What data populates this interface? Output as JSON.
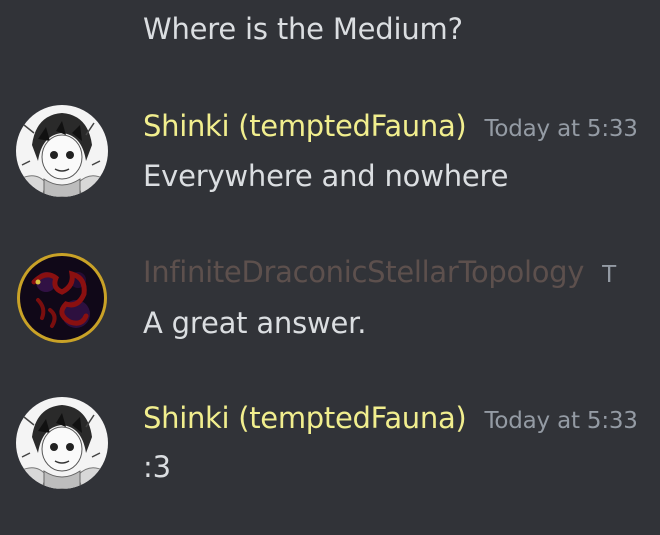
{
  "colors": {
    "background": "#313338",
    "text": "#dbdee1",
    "timestamp": "#949ba4"
  },
  "messages": [
    {
      "text": "Where is the Medium?"
    },
    {
      "author": "Shinki (temptedFauna)",
      "author_color": "#f1ee8e",
      "timestamp": "Today at 5:33",
      "text": "Everywhere and nowhere",
      "avatar_icon": "anime-girl-sketch-avatar"
    },
    {
      "author": "InfiniteDraconicStellarTopology",
      "author_color": "#5d504d",
      "timestamp": "T",
      "text": "A great answer.",
      "avatar_icon": "dragon-avatar"
    },
    {
      "author": "Shinki (temptedFauna)",
      "author_color": "#f1ee8e",
      "timestamp": "Today at 5:33",
      "text": ":3",
      "avatar_icon": "anime-girl-sketch-avatar"
    }
  ]
}
